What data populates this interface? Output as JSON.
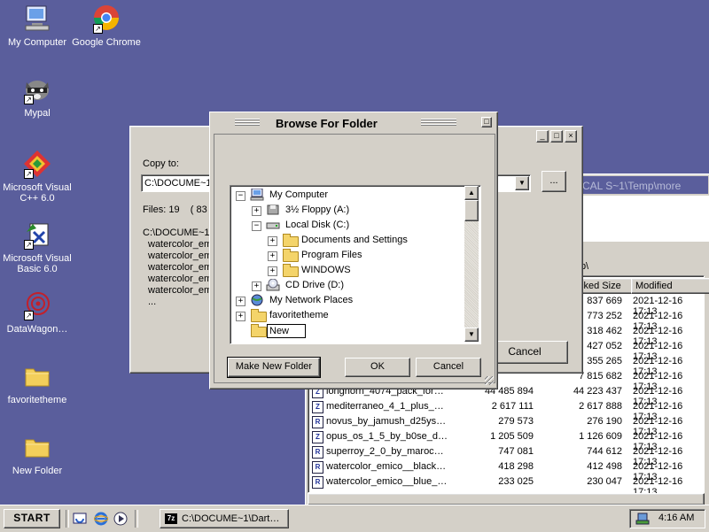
{
  "desktop": {
    "icons": [
      {
        "label": "My Computer"
      },
      {
        "label": "Google Chrome"
      },
      {
        "label": "Mypal"
      },
      {
        "label": "Microsoft Visual C++ 6.0"
      },
      {
        "label": "Microsoft Visual Basic 6.0"
      },
      {
        "label": "DataWagon…"
      },
      {
        "label": "favoritetheme"
      },
      {
        "label": "New Folder"
      }
    ]
  },
  "copy_window": {
    "copy_to_label": "Copy to:",
    "path_value": "C:\\DOCUME~1\\",
    "browse_button": "...",
    "files_info": "Files: 19    ( 83 1",
    "list_path": "C:\\DOCUME~1\\",
    "items": [
      "watercolor_emi",
      "watercolor_emi",
      "watercolor_emi",
      "watercolor_emi",
      "watercolor_emi",
      "..."
    ],
    "cancel_button": "Cancel"
  },
  "file_manager": {
    "path_fragment": "CAL S~1\\Temp\\more",
    "zip_fragment": "zip\\",
    "columns": {
      "packed": "cked Size",
      "modified": "Modified"
    },
    "top_rows": [
      {
        "packed": "837 669",
        "modified": "2021-12-16 17:13"
      },
      {
        "packed": "773 252",
        "modified": "2021-12-16 17:13"
      },
      {
        "packed": "318 462",
        "modified": "2021-12-16 17:13"
      },
      {
        "packed": "427 052",
        "modified": "2021-12-16 17:13"
      },
      {
        "packed": "355 265",
        "modified": "2021-12-16 17:13"
      },
      {
        "packed": "7 815 682",
        "modified": "2021-12-16 17:13"
      }
    ],
    "rows": [
      {
        "icon": "Z",
        "name": "longhorn_4074_pack_for…",
        "size": "44 485 894",
        "packed": "44 223 437",
        "modified": "2021-12-16 17:13"
      },
      {
        "icon": "Z",
        "name": "mediterraneo_4_1_plus_…",
        "size": "2 617 111",
        "packed": "2 617 888",
        "modified": "2021-12-16 17:13"
      },
      {
        "icon": "R",
        "name": "novus_by_jamush_d25ys…",
        "size": "279 573",
        "packed": "276 190",
        "modified": "2021-12-16 17:13"
      },
      {
        "icon": "Z",
        "name": "opus_os_1_5_by_b0se_d…",
        "size": "1 205 509",
        "packed": "1 126 609",
        "modified": "2021-12-16 17:13"
      },
      {
        "icon": "R",
        "name": "superroy_2_0_by_maroc…",
        "size": "747 081",
        "packed": "744 612",
        "modified": "2021-12-16 17:13"
      },
      {
        "icon": "R",
        "name": "watercolor_emico__black…",
        "size": "418 298",
        "packed": "412 498",
        "modified": "2021-12-16 17:13"
      },
      {
        "icon": "R",
        "name": "watercolor_emico__blue_…",
        "size": "233 025",
        "packed": "230 047",
        "modified": "2021-12-16 17:13"
      }
    ]
  },
  "browse_dialog": {
    "title": "Browse For Folder",
    "tree": [
      {
        "label": "My Computer",
        "pm": "−"
      },
      {
        "label": "3½ Floppy (A:)",
        "pm": "+"
      },
      {
        "label": "Local Disk (C:)",
        "pm": "−"
      },
      {
        "label": "Documents and Settings",
        "pm": "+"
      },
      {
        "label": "Program Files",
        "pm": "+"
      },
      {
        "label": "WINDOWS",
        "pm": "+"
      },
      {
        "label": "CD Drive (D:)",
        "pm": "+"
      },
      {
        "label": "My Network Places",
        "pm": "+"
      },
      {
        "label": "favoritetheme",
        "pm": "+"
      },
      {
        "label": "New",
        "pm": ""
      }
    ],
    "make_new_folder": "Make New Folder",
    "ok": "OK",
    "cancel": "Cancel"
  },
  "taskbar": {
    "start": "START",
    "task_label": "C:\\DOCUME~1\\Dart…",
    "task_icon": "7z",
    "clock": "4:16 AM"
  },
  "colors": {
    "desktop": "#5a5e9c",
    "face": "#d4d0c8",
    "selection": "#0a246a"
  }
}
